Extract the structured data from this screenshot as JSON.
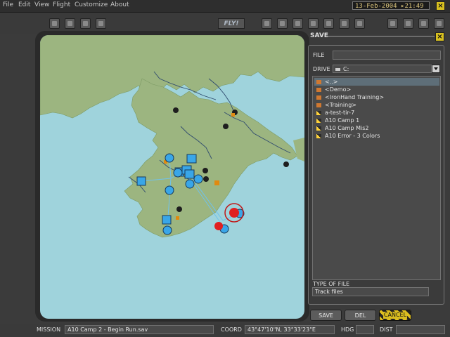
{
  "menu": [
    "File",
    "Edit",
    "View",
    "Flight",
    "Customize",
    "About"
  ],
  "datetime": "13-Feb-2004  ▸21:49",
  "toolbar": {
    "fly_label": "FLY!"
  },
  "save_panel": {
    "title": "SAVE",
    "file_label": "FILE",
    "file_value": "",
    "drive_label": "DRIVE",
    "drive_value": "C:",
    "files": [
      "<..>",
      "<Demo>",
      "<IronHand Training>",
      "<Training>",
      "a-test-tir-7",
      "A10 Camp 1",
      "A10 Camp Mis2",
      "A10 Error - 3 Colors"
    ],
    "type_label": "TYPE OF FILE",
    "type_value": "Track files",
    "buttons": {
      "save": "SAVE",
      "del": "DEL",
      "cancel": "CANCEL"
    }
  },
  "status": {
    "mission_label": "MISSION",
    "mission_value": "A10 Camp 2 - Begin Run.sav",
    "coord_label": "COORD",
    "coord_value": "43°47'10\"N, 33°33'23\"E",
    "hdg_label": "HDG",
    "hdg_value": "",
    "dist_label": "DIST",
    "dist_value": ""
  },
  "colors": {
    "sea": "#9fd3dc",
    "land": "#9cb580",
    "unit_blue": "#39a6e8",
    "unit_red": "#e02020",
    "accent": "#d8c020"
  }
}
